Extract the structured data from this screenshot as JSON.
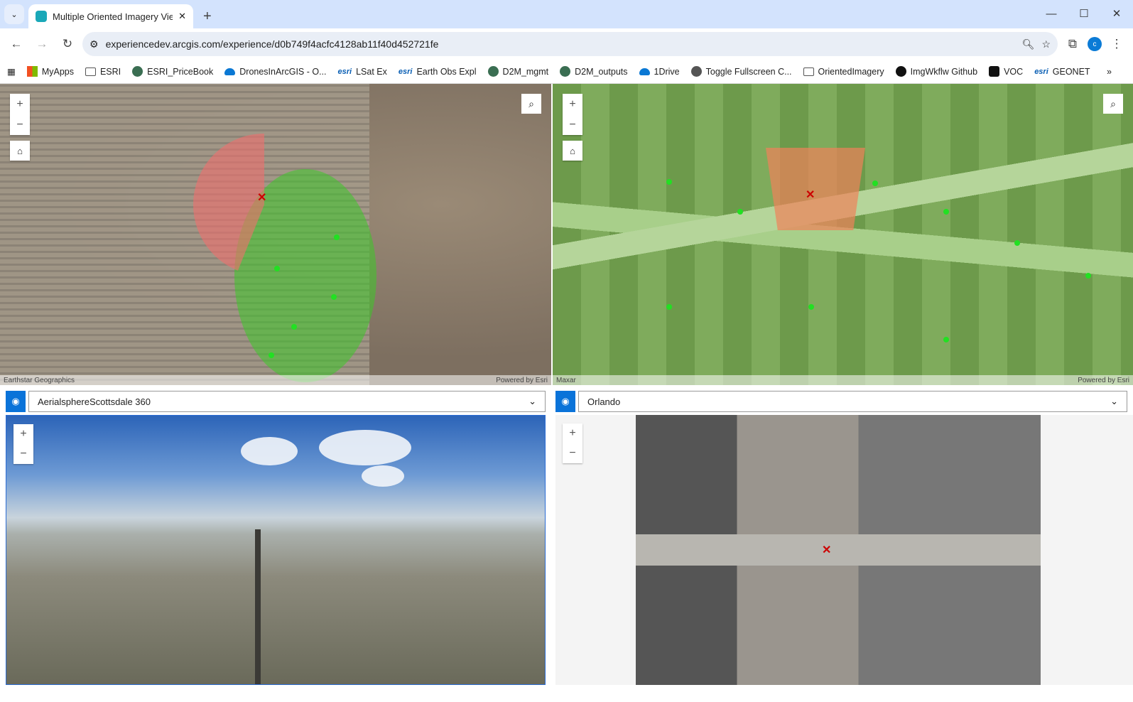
{
  "browser": {
    "tab_title": "Multiple Oriented Imagery View",
    "url": "experiencedev.arcgis.com/experience/d0b749f4acfc4128ab11f40d452721fe",
    "profile_initial": "c"
  },
  "bookmarks": [
    {
      "label": "MyApps",
      "icon": "ms"
    },
    {
      "label": "ESRI",
      "icon": "f"
    },
    {
      "label": "ESRI_PriceBook",
      "icon": "g"
    },
    {
      "label": "DronesInArcGIS - O...",
      "icon": "cl"
    },
    {
      "label": "LSat Ex",
      "icon": "esri"
    },
    {
      "label": "Earth Obs Expl",
      "icon": "esri"
    },
    {
      "label": "D2M_mgmt",
      "icon": "g"
    },
    {
      "label": "D2M_outputs",
      "icon": "g"
    },
    {
      "label": "1Drive",
      "icon": "cl"
    },
    {
      "label": "Toggle Fullscreen C...",
      "icon": "g"
    },
    {
      "label": "OrientedImagery",
      "icon": "f"
    },
    {
      "label": "ImgWkflw Github",
      "icon": "g"
    },
    {
      "label": "VOC",
      "icon": "g"
    },
    {
      "label": "GEONET",
      "icon": "esri"
    }
  ],
  "esri_label": "esri",
  "maps": {
    "left": {
      "attribution": "Earthstar Geographics",
      "powered": "Powered by Esri"
    },
    "right": {
      "attribution": "Maxar",
      "powered": "Powered by Esri"
    }
  },
  "controls": {
    "zoom_in": "+",
    "zoom_out": "−",
    "home": "⌂",
    "search": "⌕",
    "eye": "◉",
    "chevron": "⌄",
    "marker": "✕"
  },
  "viewers": {
    "left": {
      "selected": "AerialsphereScottsdale 360"
    },
    "right": {
      "selected": "Orlando"
    }
  }
}
